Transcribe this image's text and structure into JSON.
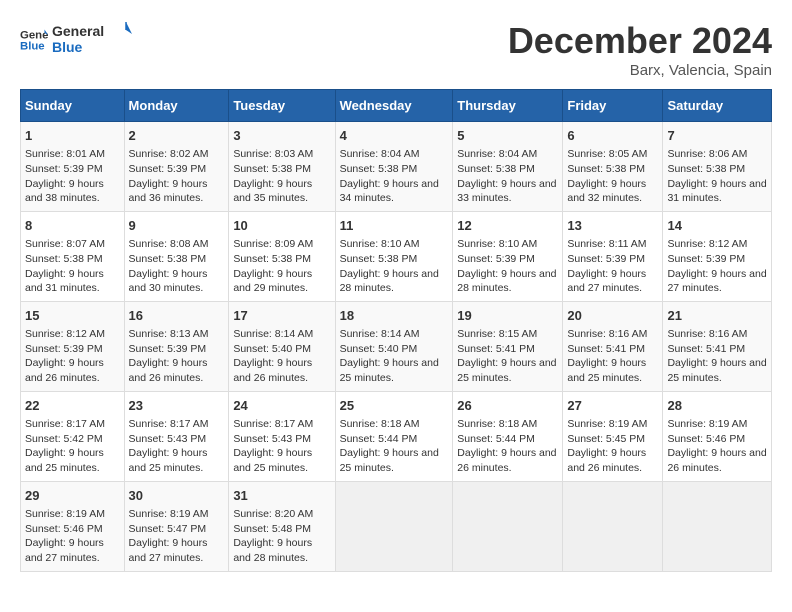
{
  "logo": {
    "line1": "General",
    "line2": "Blue"
  },
  "title": "December 2024",
  "location": "Barx, Valencia, Spain",
  "days_of_week": [
    "Sunday",
    "Monday",
    "Tuesday",
    "Wednesday",
    "Thursday",
    "Friday",
    "Saturday"
  ],
  "weeks": [
    [
      {
        "day": 1,
        "sunrise": "8:01 AM",
        "sunset": "5:39 PM",
        "daylight": "9 hours and 38 minutes."
      },
      {
        "day": 2,
        "sunrise": "8:02 AM",
        "sunset": "5:39 PM",
        "daylight": "9 hours and 36 minutes."
      },
      {
        "day": 3,
        "sunrise": "8:03 AM",
        "sunset": "5:38 PM",
        "daylight": "9 hours and 35 minutes."
      },
      {
        "day": 4,
        "sunrise": "8:04 AM",
        "sunset": "5:38 PM",
        "daylight": "9 hours and 34 minutes."
      },
      {
        "day": 5,
        "sunrise": "8:04 AM",
        "sunset": "5:38 PM",
        "daylight": "9 hours and 33 minutes."
      },
      {
        "day": 6,
        "sunrise": "8:05 AM",
        "sunset": "5:38 PM",
        "daylight": "9 hours and 32 minutes."
      },
      {
        "day": 7,
        "sunrise": "8:06 AM",
        "sunset": "5:38 PM",
        "daylight": "9 hours and 31 minutes."
      }
    ],
    [
      {
        "day": 8,
        "sunrise": "8:07 AM",
        "sunset": "5:38 PM",
        "daylight": "9 hours and 31 minutes."
      },
      {
        "day": 9,
        "sunrise": "8:08 AM",
        "sunset": "5:38 PM",
        "daylight": "9 hours and 30 minutes."
      },
      {
        "day": 10,
        "sunrise": "8:09 AM",
        "sunset": "5:38 PM",
        "daylight": "9 hours and 29 minutes."
      },
      {
        "day": 11,
        "sunrise": "8:10 AM",
        "sunset": "5:38 PM",
        "daylight": "9 hours and 28 minutes."
      },
      {
        "day": 12,
        "sunrise": "8:10 AM",
        "sunset": "5:39 PM",
        "daylight": "9 hours and 28 minutes."
      },
      {
        "day": 13,
        "sunrise": "8:11 AM",
        "sunset": "5:39 PM",
        "daylight": "9 hours and 27 minutes."
      },
      {
        "day": 14,
        "sunrise": "8:12 AM",
        "sunset": "5:39 PM",
        "daylight": "9 hours and 27 minutes."
      }
    ],
    [
      {
        "day": 15,
        "sunrise": "8:12 AM",
        "sunset": "5:39 PM",
        "daylight": "9 hours and 26 minutes."
      },
      {
        "day": 16,
        "sunrise": "8:13 AM",
        "sunset": "5:39 PM",
        "daylight": "9 hours and 26 minutes."
      },
      {
        "day": 17,
        "sunrise": "8:14 AM",
        "sunset": "5:40 PM",
        "daylight": "9 hours and 26 minutes."
      },
      {
        "day": 18,
        "sunrise": "8:14 AM",
        "sunset": "5:40 PM",
        "daylight": "9 hours and 25 minutes."
      },
      {
        "day": 19,
        "sunrise": "8:15 AM",
        "sunset": "5:41 PM",
        "daylight": "9 hours and 25 minutes."
      },
      {
        "day": 20,
        "sunrise": "8:16 AM",
        "sunset": "5:41 PM",
        "daylight": "9 hours and 25 minutes."
      },
      {
        "day": 21,
        "sunrise": "8:16 AM",
        "sunset": "5:41 PM",
        "daylight": "9 hours and 25 minutes."
      }
    ],
    [
      {
        "day": 22,
        "sunrise": "8:17 AM",
        "sunset": "5:42 PM",
        "daylight": "9 hours and 25 minutes."
      },
      {
        "day": 23,
        "sunrise": "8:17 AM",
        "sunset": "5:43 PM",
        "daylight": "9 hours and 25 minutes."
      },
      {
        "day": 24,
        "sunrise": "8:17 AM",
        "sunset": "5:43 PM",
        "daylight": "9 hours and 25 minutes."
      },
      {
        "day": 25,
        "sunrise": "8:18 AM",
        "sunset": "5:44 PM",
        "daylight": "9 hours and 25 minutes."
      },
      {
        "day": 26,
        "sunrise": "8:18 AM",
        "sunset": "5:44 PM",
        "daylight": "9 hours and 26 minutes."
      },
      {
        "day": 27,
        "sunrise": "8:19 AM",
        "sunset": "5:45 PM",
        "daylight": "9 hours and 26 minutes."
      },
      {
        "day": 28,
        "sunrise": "8:19 AM",
        "sunset": "5:46 PM",
        "daylight": "9 hours and 26 minutes."
      }
    ],
    [
      {
        "day": 29,
        "sunrise": "8:19 AM",
        "sunset": "5:46 PM",
        "daylight": "9 hours and 27 minutes."
      },
      {
        "day": 30,
        "sunrise": "8:19 AM",
        "sunset": "5:47 PM",
        "daylight": "9 hours and 27 minutes."
      },
      {
        "day": 31,
        "sunrise": "8:20 AM",
        "sunset": "5:48 PM",
        "daylight": "9 hours and 28 minutes."
      },
      null,
      null,
      null,
      null
    ]
  ]
}
